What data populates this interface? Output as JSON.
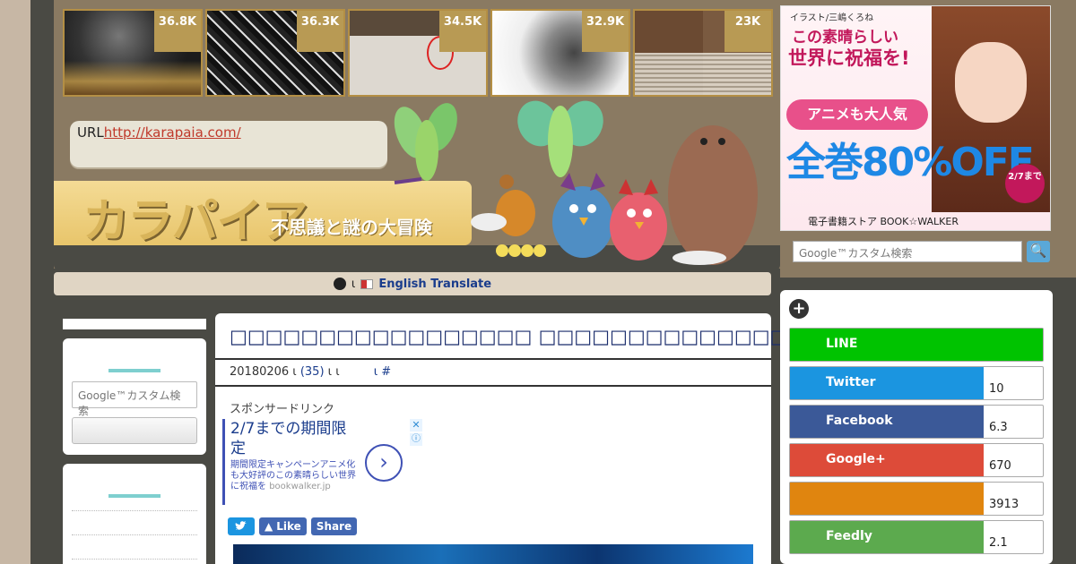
{
  "thumbnails": [
    {
      "count": "36.8K"
    },
    {
      "count": "36.3K"
    },
    {
      "count": "34.5K"
    },
    {
      "count": "32.9K"
    },
    {
      "count": "23K"
    }
  ],
  "site": {
    "url_label": "URL",
    "url": "http://karapaia.com/",
    "logo": "カラパイア",
    "tagline": "不思議と謎の大冒険"
  },
  "translate": {
    "sep": "ι",
    "label": "English Translate"
  },
  "article": {
    "title": "□□□□□□□□□□□□□□□□□ □□□□□□□□□□□□□□□□□□□□□□□□□□□",
    "date": "20180206 ι",
    "comments": "(35)",
    "meta_tail": " ι ι",
    "hash": "ι #",
    "sponsor": "スポンサードリンク",
    "ad_headline": "2/7までの期間限定",
    "ad_body": "期間限定キャンペーンアニメ化も大好評のこの素晴らしい世界に祝福を",
    "ad_domain": "bookwalker.jp",
    "ad_close": "✕",
    "ad_info": "ⓘ",
    "ad_arrow": "›",
    "share_like": "Like",
    "share_share": "Share"
  },
  "left_sidebar": {
    "search_placeholder": "Google™カスタム検索"
  },
  "banner_ad": {
    "credit": "イラスト/三嶋くろね",
    "line1": "この素晴らしい",
    "line2": "世界に祝福を!",
    "pill": "アニメも大人気",
    "big": "全巻80%OFF",
    "date": "2/7まで",
    "footer": "電子書籍ストア BOOK☆WALKER"
  },
  "right_search": {
    "placeholder": "Google™カスタム検索",
    "button_icon": "🔍"
  },
  "share_panel": {
    "plus": "+",
    "rows": [
      {
        "label": "LINE",
        "count": "",
        "color": "#00c300"
      },
      {
        "label": "Twitter",
        "count": "10",
        "color": "#1b95e0"
      },
      {
        "label": "Facebook",
        "count": "6.3",
        "color": "#3b5998"
      },
      {
        "label": "Google+",
        "count": "670",
        "color": "#dd4b39"
      },
      {
        "label": "",
        "count": "3913",
        "color": "#e0850f"
      },
      {
        "label": "Feedly",
        "count": "2.1",
        "color": "#5caa4e"
      }
    ]
  }
}
